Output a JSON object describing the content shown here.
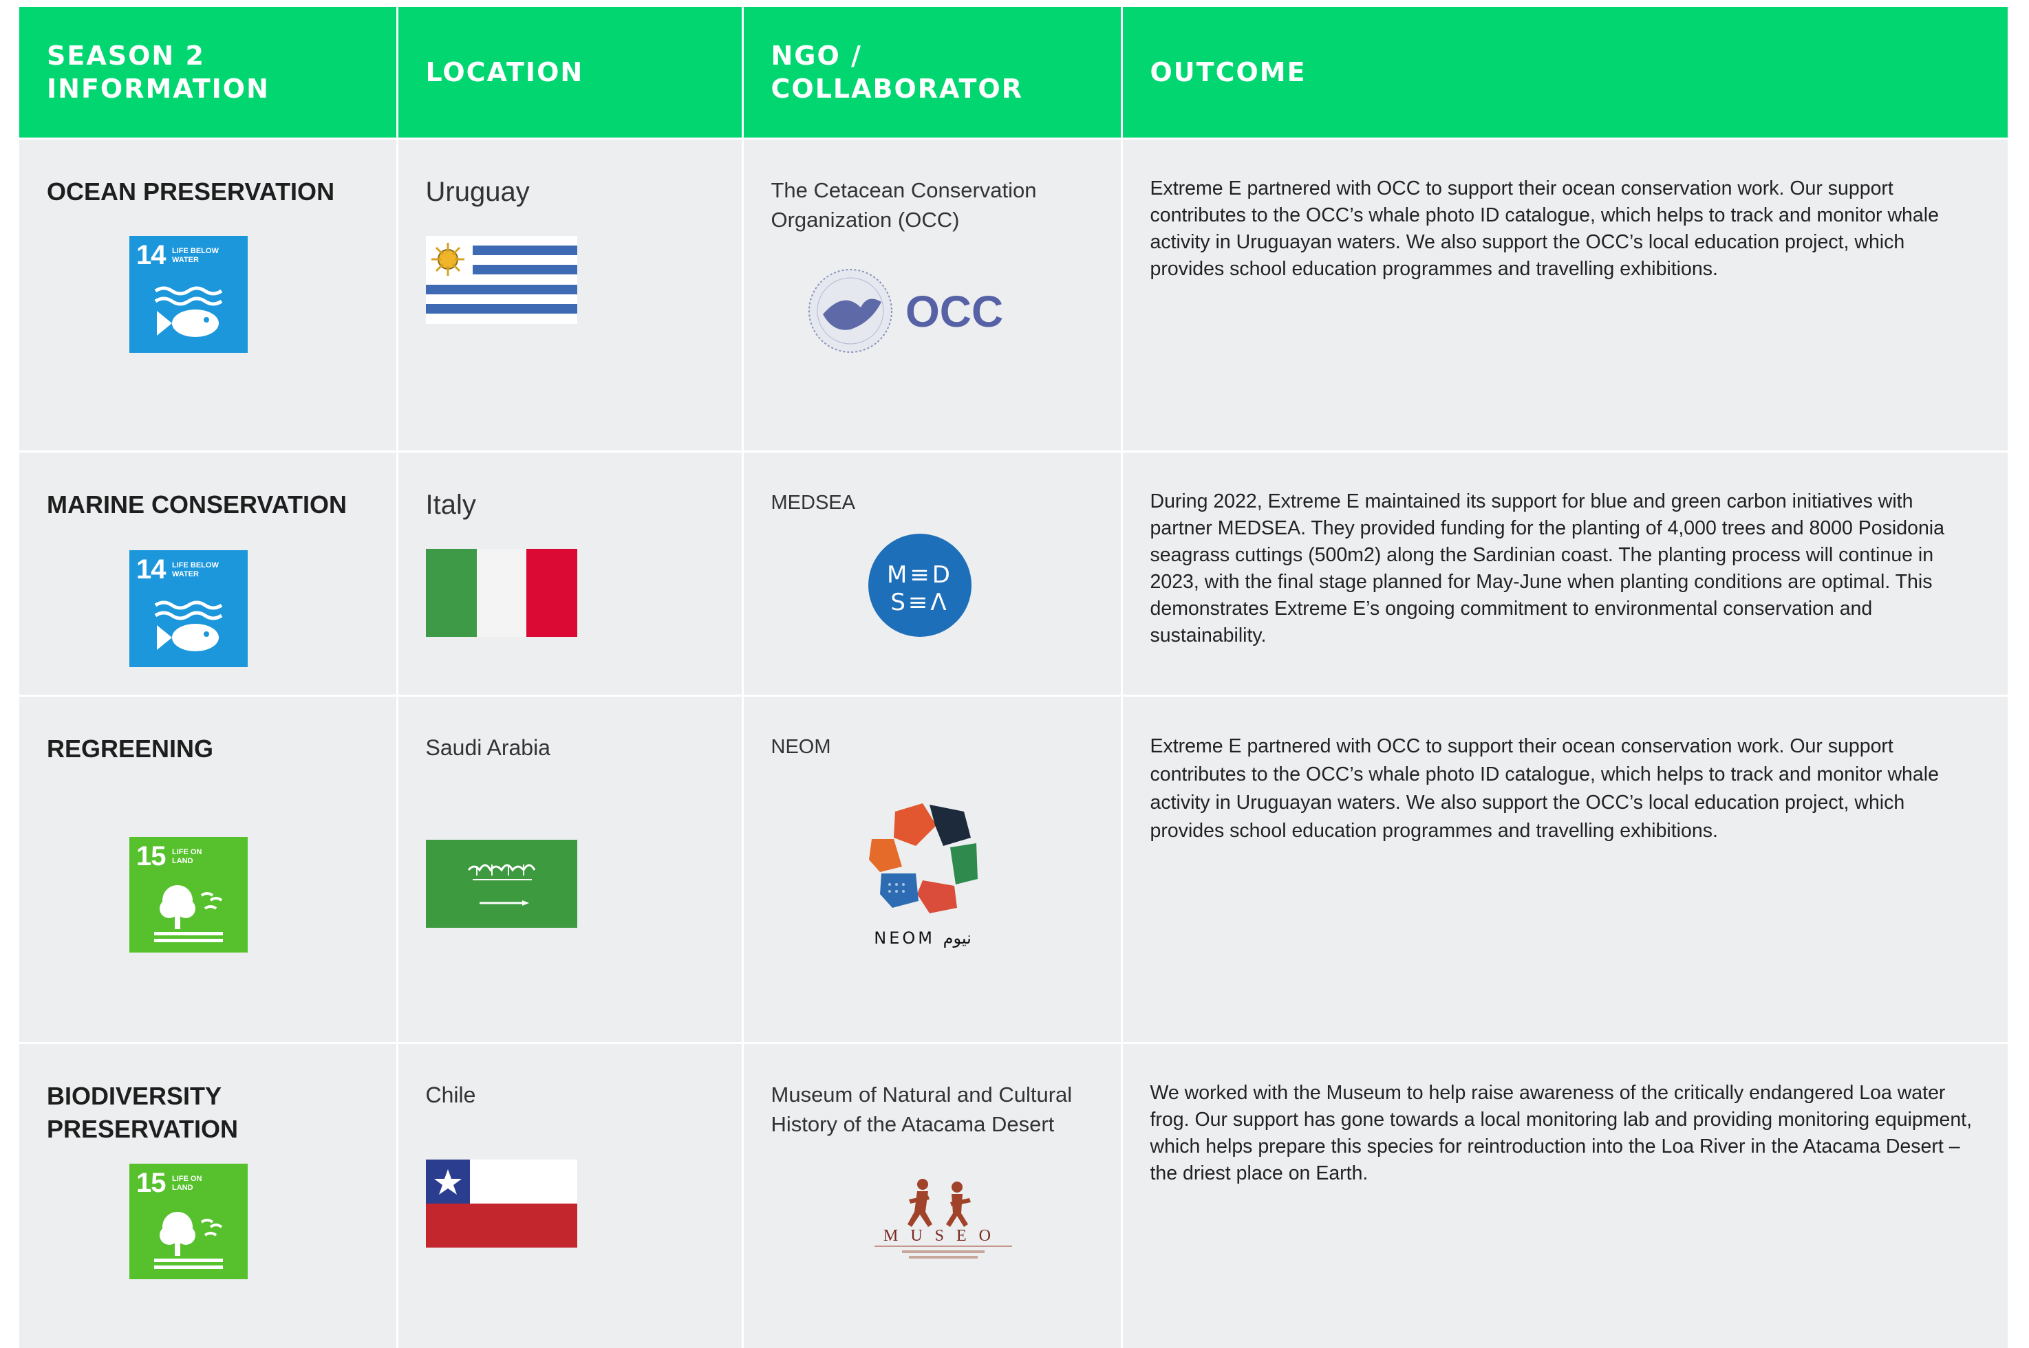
{
  "headers": {
    "season": "SEASON 2 INFORMATION",
    "location": "LOCATION",
    "ngo": "NGO / COLLABORATOR",
    "outcome": "OUTCOME"
  },
  "rows": [
    {
      "category": "OCEAN PRESERVATION",
      "sdg": {
        "number": "14",
        "label": "LIFE BELOW WATER",
        "color": "#1d97dc",
        "icon": "fish-icon"
      },
      "location": "Uruguay",
      "flag": "uruguay-flag",
      "ngo": "The Cetacean Conservation Organization (OCC)",
      "logo_text": "OCC",
      "outcome": "Extreme E partnered with OCC to support their ocean conservation work. Our support contributes to the OCC’s whale photo ID catalogue, which helps to track and monitor whale activity in Uruguayan waters. We also support the OCC’s local education project, which provides school education programmes and travelling exhibitions."
    },
    {
      "category": "MARINE CONSERVATION",
      "sdg": {
        "number": "14",
        "label": "LIFE BELOW WATER",
        "color": "#1d97dc",
        "icon": "fish-icon"
      },
      "location": "Italy",
      "flag": "italy-flag",
      "ngo": "MEDSEA",
      "logo_text": "MEDSEA",
      "outcome": "During 2022, Extreme E maintained its support for blue and green carbon initiatives with partner MEDSEA. They provided funding for the planting of 4,000 trees and 8000 Posidonia seagrass cuttings (500m2) along the Sardinian coast. The planting process will continue in 2023, with the final stage planned for May-June when planting conditions are optimal. This demonstrates Extreme E’s ongoing commitment to environmental conservation and sustainability."
    },
    {
      "category": "REGREENING",
      "sdg": {
        "number": "15",
        "label": "LIFE ON LAND",
        "color": "#56c12d",
        "icon": "tree-icon"
      },
      "location": "Saudi Arabia",
      "flag": "saudi-arabia-flag",
      "ngo": "NEOM",
      "logo_text": "NEOM نيوم",
      "outcome": "Extreme E partnered with OCC to support their ocean conservation work. Our support contributes to the OCC’s whale photo ID catalogue, which helps to track and monitor whale activity in Uruguayan waters. We also support the OCC’s local education project, which provides school education programmes and travelling exhibitions."
    },
    {
      "category": "BIODIVERSITY PRESERVATION",
      "sdg": {
        "number": "15",
        "label": "LIFE ON LAND",
        "color": "#56c12d",
        "icon": "tree-icon"
      },
      "location": "Chile",
      "flag": "chile-flag",
      "ngo": "Museum of Natural and Cultural History of the Atacama Desert",
      "logo_text": "MUSEO",
      "outcome": "We worked with the Museum to help raise awareness of the critically endangered Loa water frog. Our support has gone towards a local monitoring lab and providing monitoring equipment, which helps prepare this species for reintroduction into the Loa River in the Atacama Desert – the driest place on Earth."
    }
  ]
}
